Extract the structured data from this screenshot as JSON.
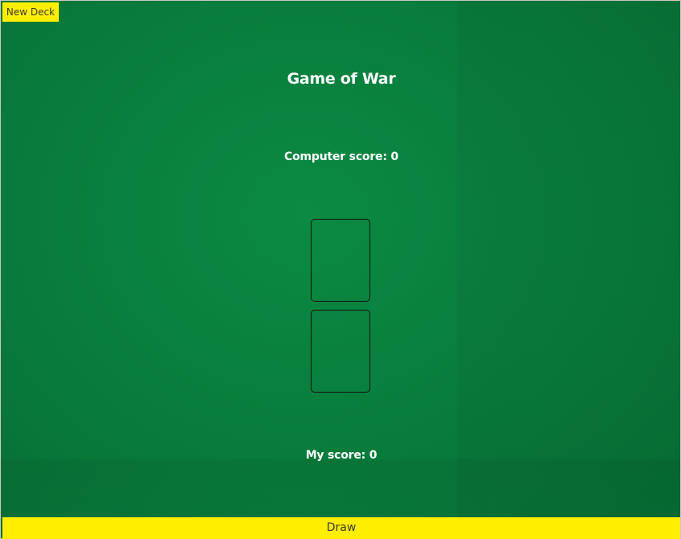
{
  "toolbar": {
    "new_deck_label": "New Deck"
  },
  "game": {
    "title": "Game of War",
    "computer_score_label": "Computer score: 0",
    "my_score_label": "My score: 0"
  },
  "controls": {
    "draw_label": "Draw"
  },
  "colors": {
    "table_felt": "#087a3a",
    "button_yellow": "#ffee00",
    "text_white": "#ffffff"
  }
}
